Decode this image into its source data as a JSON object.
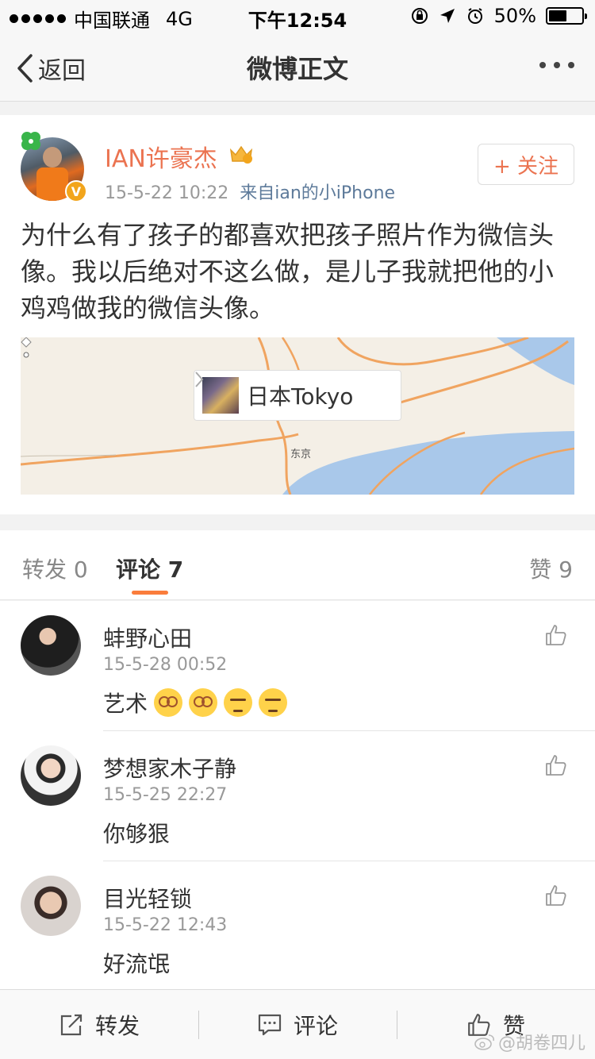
{
  "status_bar": {
    "carrier": "中国联通",
    "network": "4G",
    "time": "下午12:54",
    "battery": "50%",
    "battery_level": 0.5
  },
  "nav": {
    "back_label": "返回",
    "title": "微博正文"
  },
  "post": {
    "username": "IAN许豪杰",
    "time": "15-5-22 10:22",
    "source": "来自ian的小iPhone",
    "follow_label": "+ 关注",
    "text": "为什么有了孩子的都喜欢把孩子照片作为微信头像。我以后绝对不这么做，是儿子我就把他的小鸡鸡做我的微信头像。",
    "location": "日本Tokyo",
    "map_label": "东京"
  },
  "tabs": {
    "repost": "转发 0",
    "comment": "评论 7",
    "like": "赞 9"
  },
  "comments": [
    {
      "name": "蚌野心田",
      "time": "15-5-28 00:52",
      "text": "艺术"
    },
    {
      "name": "梦想家木子静",
      "time": "15-5-25 22:27",
      "text": "你够狠"
    },
    {
      "name": "目光轻锁",
      "time": "15-5-22 12:43",
      "text": "好流氓"
    }
  ],
  "bottom_bar": {
    "repost": "转发",
    "comment": "评论",
    "like": "赞"
  },
  "watermark": "@胡卷四儿",
  "colors": {
    "accent": "#eb7350",
    "tab_underline": "#fa7d3c",
    "map_water": "#a9c8ea",
    "map_road": "#f0a460"
  }
}
